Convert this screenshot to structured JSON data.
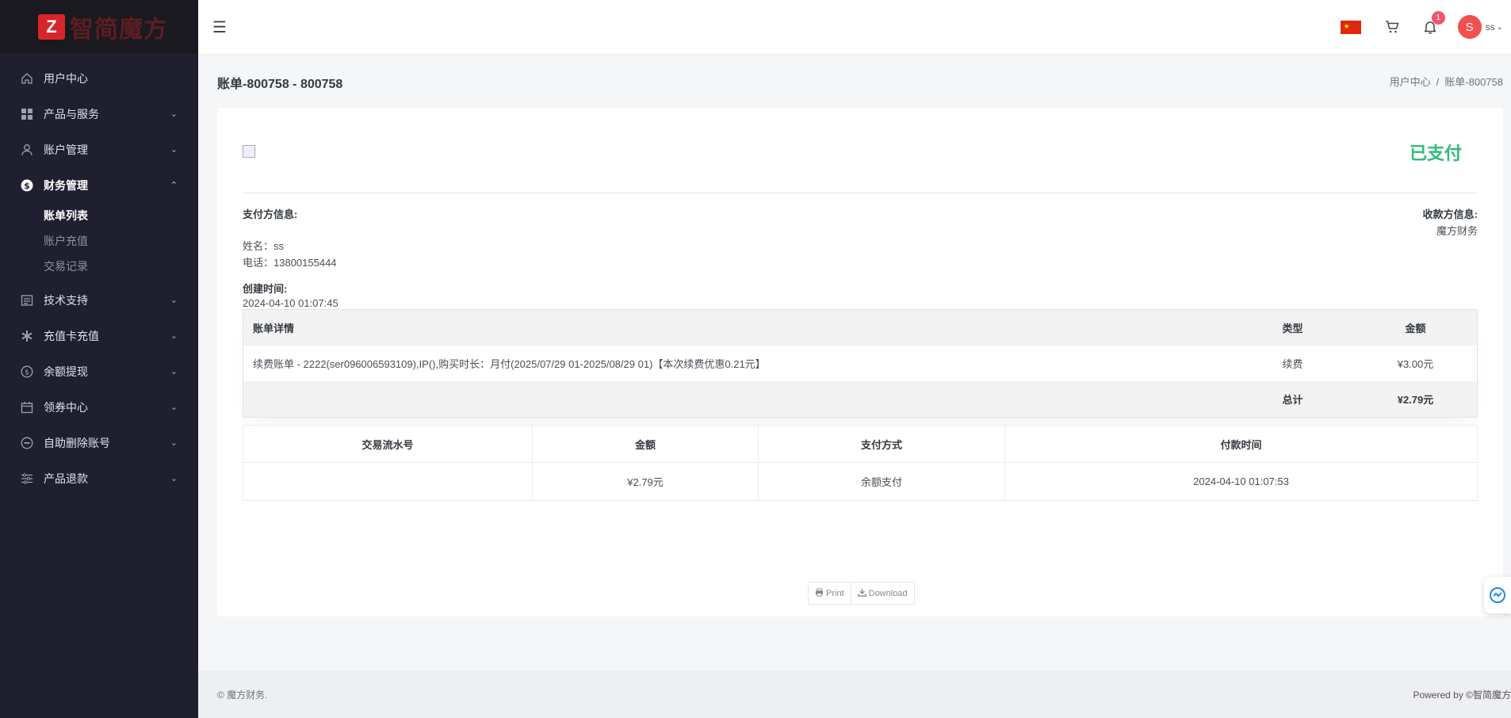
{
  "brand": {
    "logo_letter": "Z",
    "logo_text": "智简魔方"
  },
  "sidebar": {
    "items": [
      {
        "label": "用户中心",
        "icon": "home-icon"
      },
      {
        "label": "产品与服务",
        "icon": "grid-icon"
      },
      {
        "label": "账户管理",
        "icon": "user-icon"
      },
      {
        "label": "财务管理",
        "icon": "dollar-icon"
      },
      {
        "label": "技术支持",
        "icon": "list-icon"
      },
      {
        "label": "充值卡充值",
        "icon": "asterisk-icon"
      },
      {
        "label": "余额提现",
        "icon": "dollar-circle-icon"
      },
      {
        "label": "领券中心",
        "icon": "calendar-icon"
      },
      {
        "label": "自助删除账号",
        "icon": "minus-circle-icon"
      },
      {
        "label": "产品退款",
        "icon": "sliders-icon"
      }
    ],
    "finance_sub": [
      "账单列表",
      "账户充值",
      "交易记录"
    ]
  },
  "topbar": {
    "notification_count": "1",
    "avatar_letter": "S",
    "user_name": "ss"
  },
  "page": {
    "title": "账单-800758 - 800758",
    "breadcrumb_home": "用户中心",
    "breadcrumb_current": "账单-800758"
  },
  "invoice": {
    "status": "已支付",
    "payer_title": "支付方信息:",
    "payer_name": "姓名：ss",
    "payer_phone": "电话：13800155444",
    "created_title": "创建时间:",
    "created_value": "2024-04-10 01:07:45",
    "payee_title": "收款方信息:",
    "payee_name": "魔方财务",
    "detail_headers": {
      "desc": "账单详情",
      "type": "类型",
      "amount": "金额"
    },
    "detail_rows": [
      {
        "desc": "续费账单 - 2222(ser096006593109),IP(),购买时长：月付(2025/07/29 01-2025/08/29 01)【本次续费优惠0.21元】",
        "type": "续费",
        "amount": "¥3.00元"
      }
    ],
    "total_label": "总计",
    "total_value": "¥2.79元"
  },
  "transactions": {
    "headers": {
      "txn_id": "交易流水号",
      "amount": "金额",
      "method": "支付方式",
      "time": "付款时间"
    },
    "rows": [
      {
        "txn_id": "",
        "amount": "¥2.79元",
        "method": "余额支付",
        "time": "2024-04-10 01:07:53"
      }
    ]
  },
  "actions": {
    "print": "Print",
    "download": "Download"
  },
  "footer": {
    "left": "© 魔方财务.",
    "right": "Powered by ©智简魔方"
  },
  "colors": {
    "sidebar_bg": "#1f1f2f",
    "paid_green": "#2fbc7b",
    "badge_red": "#f1556c",
    "brand_red": "#d6262a"
  }
}
